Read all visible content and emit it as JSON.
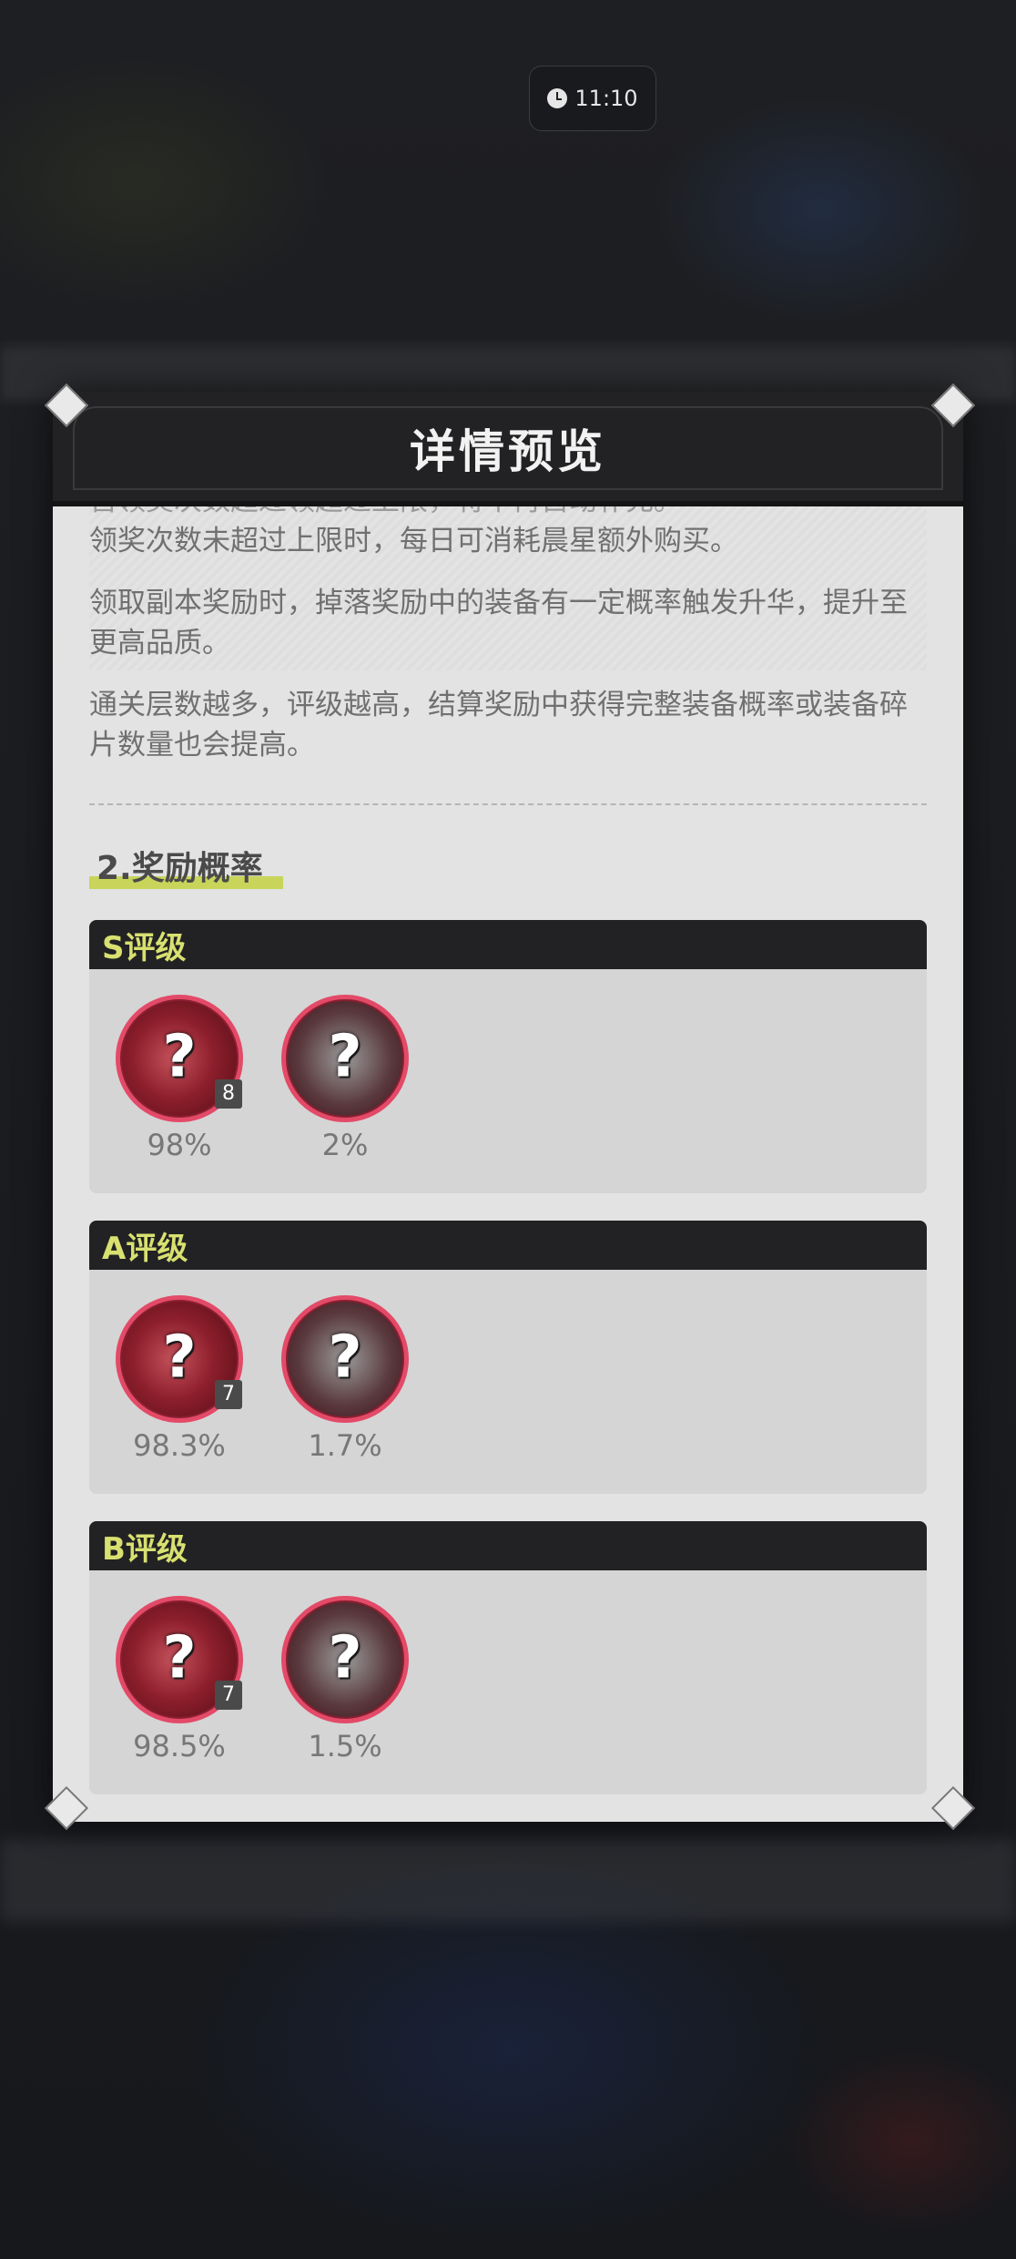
{
  "status": {
    "time": "11:10"
  },
  "dialog": {
    "title": "详情预览",
    "paragraphs": [
      "召领奖次数超过领超过上限，将不再自动补充。",
      "领奖次数未超过上限时，每日可消耗晨星额外购买。",
      "领取副本奖励时，掉落奖励中的装备有一定概率触发升华，提升至更高品质。",
      "通关层数越多，评级越高，结算奖励中获得完整装备概率或装备碎片数量也会提高。"
    ],
    "section_title": "2.奖励概率",
    "grades": [
      {
        "label": "S评级",
        "items": [
          {
            "icon": "equipment-fragment-icon",
            "qty": "8",
            "pct": "98%"
          },
          {
            "icon": "equipment-coat-icon",
            "qty": "",
            "pct": "2%"
          }
        ]
      },
      {
        "label": "A评级",
        "items": [
          {
            "icon": "equipment-fragment-icon",
            "qty": "7",
            "pct": "98.3%"
          },
          {
            "icon": "equipment-coat-icon",
            "qty": "",
            "pct": "1.7%"
          }
        ]
      },
      {
        "label": "B评级",
        "items": [
          {
            "icon": "equipment-fragment-icon",
            "qty": "7",
            "pct": "98.5%"
          },
          {
            "icon": "equipment-coat-icon",
            "qty": "",
            "pct": "1.5%"
          }
        ]
      }
    ]
  },
  "colors": {
    "accent": "#d8e070",
    "ring": "#e34a68",
    "header": "#222224"
  }
}
